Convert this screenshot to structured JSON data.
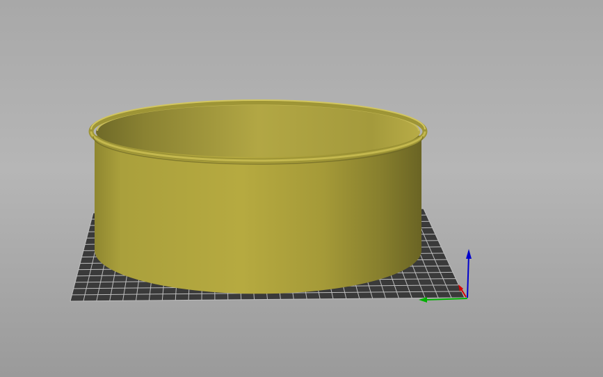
{
  "viewport": {
    "background_top": "#a8a8a8",
    "background_bottom": "#9a9a9a"
  },
  "bed": {
    "plate_color": "#3a3a3a",
    "grid_color": "#bfbfbf"
  },
  "model": {
    "shape": "open-cylinder",
    "color_base": "#b1a63c",
    "color_light": "#bdb146",
    "color_dark": "#6e6826"
  },
  "axes": {
    "x_color": "#d40000",
    "y_color": "#00b000",
    "z_color": "#0000cc"
  }
}
